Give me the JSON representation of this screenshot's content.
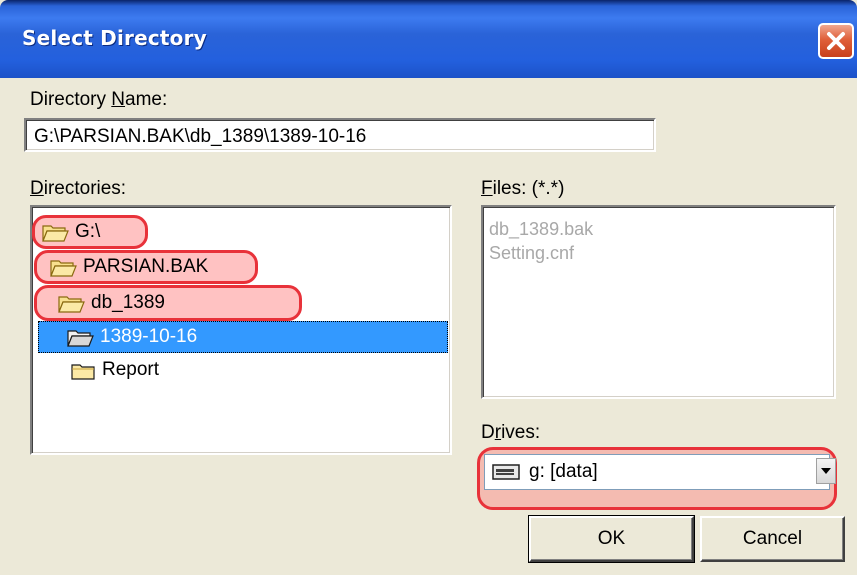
{
  "window": {
    "title": "Select Directory"
  },
  "directory_name": {
    "label_prefix": "Directory ",
    "label_accel": "N",
    "label_suffix": "ame:",
    "value": "G:\\PARSIAN.BAK\\db_1389\\1389-10-16"
  },
  "directories": {
    "label_accel": "D",
    "label_suffix": "irectories:",
    "items": [
      {
        "label": "G:\\",
        "icon": "folder-open-icon",
        "level": 0,
        "highlighted": true
      },
      {
        "label": "PARSIAN.BAK",
        "icon": "folder-open-icon",
        "level": 1,
        "highlighted": true
      },
      {
        "label": "db_1389",
        "icon": "folder-open-icon",
        "level": 2,
        "highlighted": true
      },
      {
        "label": "1389-10-16",
        "icon": "folder-open-icon",
        "level": 3,
        "selected": true
      },
      {
        "label": "Report",
        "icon": "folder-closed-icon",
        "level": 4
      }
    ]
  },
  "files": {
    "label_accel": "F",
    "label_suffix": "iles: (*.*)",
    "items": [
      "db_1389.bak",
      "Setting.cnf"
    ]
  },
  "drives": {
    "label_prefix": "D",
    "label_accel": "r",
    "label_suffix": "ives:",
    "value": "g: [data]",
    "icon": "drive-icon"
  },
  "buttons": {
    "ok": "OK",
    "cancel": "Cancel"
  },
  "colors": {
    "highlight_border": "#e8323a",
    "selection": "#3399ff",
    "titlebar": "#2a63d8",
    "disabled_text": "#a8a8a8"
  }
}
